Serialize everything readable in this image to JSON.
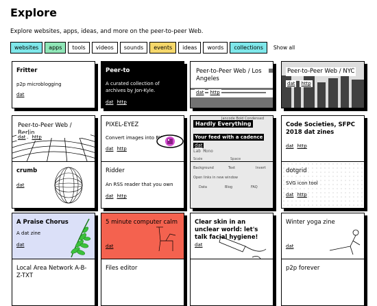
{
  "page": {
    "title": "Explore",
    "subtitle": "Explore websites, apps, ideas, and more on the peer-to-peer Web."
  },
  "filters": {
    "items": [
      {
        "label": "websites",
        "color": "#7fe7ea"
      },
      {
        "label": "apps",
        "color": "#8fe6b7"
      },
      {
        "label": "tools",
        "color": "#ffffff"
      },
      {
        "label": "videos",
        "color": "#ffffff"
      },
      {
        "label": "sounds",
        "color": "#ffffff"
      },
      {
        "label": "events",
        "color": "#f6d86b"
      },
      {
        "label": "ideas",
        "color": "#ffffff"
      },
      {
        "label": "words",
        "color": "#ffffff"
      },
      {
        "label": "collections",
        "color": "#7fe7ea"
      }
    ],
    "show_all": "Show all"
  },
  "cards": {
    "fritter": {
      "title": "Fritter",
      "desc": "p2p microblogging",
      "link1": "dat"
    },
    "peerto": {
      "title": "Peer-to",
      "desc": "A curated collection of archives by Jon-Kyle.",
      "link1": "dat",
      "link2": "http"
    },
    "la": {
      "title": "Peer-to-Peer Web / Los Angeles",
      "link1": "dat",
      "link2": "http"
    },
    "nyc": {
      "title": "Peer-to-Peer Web / NYC",
      "link1": "dat",
      "link2": "http"
    },
    "berlin": {
      "title": "Peer-to-Peer Web / Berlin",
      "link1": "dat",
      "link2": "http"
    },
    "pixeleyez": {
      "title": "PIXEL-EYEZ",
      "desc": "Convert images into PXON",
      "link1": "dat",
      "link2": "http"
    },
    "hardly": {
      "title": "Hardly Everything",
      "tagline": "Your feed with a cadence",
      "link1": "dat",
      "menu_top": "Jancode Bold Condensed",
      "mono": "Lab Mono",
      "scale": "Scale",
      "space": "Space",
      "background": "Background",
      "text": "Text",
      "invert": "Invert",
      "open_links": "Open links in new window",
      "tab_data": "Data",
      "tab_blog": "Blog",
      "tab_faq": "FAQ"
    },
    "codesoc": {
      "title": "Code Societies, SFPC 2018 dat zines",
      "link1": "dat",
      "link2": "http"
    },
    "crumb": {
      "title": "crumb",
      "link1": "dat"
    },
    "ridder": {
      "title": "Ridder",
      "desc": "An RSS reader that you own",
      "link1": "dat",
      "link2": "http"
    },
    "dotgrid": {
      "title": "dotgrid",
      "desc": "SVG icon tool",
      "link1": "dat",
      "link2": "http"
    },
    "praise": {
      "title": "A Praise Chorus",
      "desc": "A dat zine",
      "link1": "dat"
    },
    "calm": {
      "title": "5 minute computer calm",
      "link1": "dat"
    },
    "clear": {
      "title": "Clear skin in an unclear world: let's talk facial hygiene!",
      "link1": "dat"
    },
    "yoga": {
      "title": "Winter yoga zine",
      "link1": "dat"
    },
    "lan": {
      "title": "Local Area Network A-B-Z-TXT"
    },
    "files": {
      "title": "Files editor"
    },
    "p2p": {
      "title": "p2p forever"
    }
  }
}
